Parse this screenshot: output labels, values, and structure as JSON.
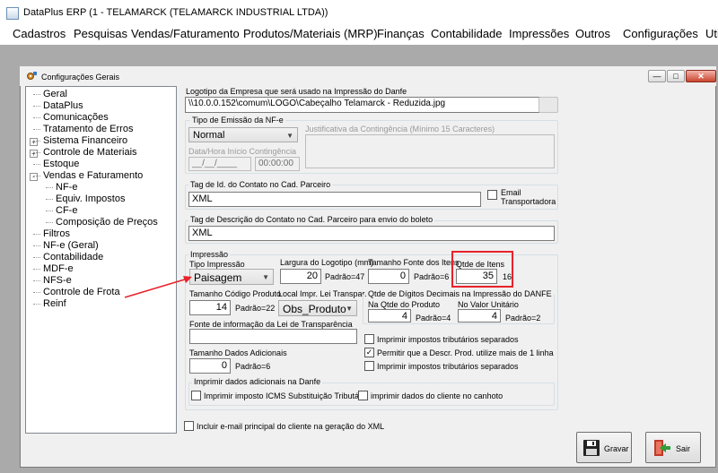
{
  "app": {
    "title": "DataPlus ERP (1 - TELAMARCK  (TELAMARCK INDUSTRIAL LTDA))"
  },
  "menu": [
    "Cadastros",
    "Pesquisas",
    "Vendas/Faturamento",
    "Produtos/Materiais (MRP)",
    "Finanças",
    "Contabilidade",
    "Impressões",
    "Outros",
    "Configurações",
    "Uti"
  ],
  "dialog": {
    "title": "Configurações Gerais"
  },
  "tree": {
    "items": [
      "Geral",
      "DataPlus",
      "Comunicações",
      "Tratamento de Erros",
      "Sistema Financeiro",
      "Controle de Materiais",
      "Estoque",
      "Vendas e Faturamento",
      "NF-e",
      "Equiv. Impostos",
      "CF-e",
      "Composição de Preços",
      "Filtros",
      "NF-e (Geral)",
      "Contabilidade",
      "MDF-e",
      "NFS-e",
      "Controle de Frota",
      "Reinf"
    ],
    "expand_marks": [
      "+",
      "+",
      "-"
    ]
  },
  "logo": {
    "label": "Logotipo da Empresa que será usado na Impressão do Danfe",
    "path": "\\\\10.0.0.152\\comum\\LOGO\\Cabeçalho Telamarck - Reduzida.jpg"
  },
  "emissao": {
    "group": "Tipo de Emissão da NF-e",
    "tipo": "Normal",
    "datahora_label": "Data/Hora Início Contingência",
    "date": "__/__/____",
    "time": "00:00:00",
    "justificativa_label": "Justificativa da Contingência (Mínimo 15 Caracteres)"
  },
  "tag_id": {
    "label": "Tag de Id. do Contato no Cad. Parceiro",
    "value": "XML",
    "email_label": "Email Transportadora"
  },
  "tag_desc": {
    "label": "Tag de Descrição do Contato no Cad. Parceiro para envio do boleto",
    "value": "XML"
  },
  "impressao": {
    "group": "Impressão",
    "tipo_label": "Tipo Impressão",
    "tipo_value": "Paisagem",
    "largura_label": "Largura do Logotipo (mm)",
    "largura_value": "20",
    "largura_padrao": "Padrão=47",
    "fonte_label": "Tamanho Fonte dos Itens",
    "fonte_value": "0",
    "fonte_padrao": "Padrão=6",
    "qtde_label": "Qtde de Itens",
    "qtde_value": "35",
    "qtde_extra": "16",
    "codigo_label": "Tamanho Código Produto",
    "codigo_value": "14",
    "codigo_padrao": "Padrão=22",
    "local_label": "Local Impr. Lei Transpar.",
    "local_value": "Obs_Produto",
    "decimais_group": "Qtde de Dígitos Decimais na Impressão do DANFE",
    "qtde_prod_label": "Na Qtde do Produto",
    "qtde_prod_value": "4",
    "qtde_prod_padrao": "Padrão=4",
    "valor_unit_label": "No Valor Unitário",
    "valor_unit_value": "4",
    "valor_unit_padrao": "Padrão=2",
    "fonte_lei_label": "Fonte de informação da Lei de Transparência",
    "dados_label": "Tamanho Dados Adicionais",
    "dados_value": "0",
    "dados_padrao": "Padrão=6",
    "chk1": "Imprimir impostos tributários separados",
    "chk2": "Permitir que a Descr. Prod. utilize mais de 1 linha",
    "chk3": "Imprimir impostos tributários separados",
    "adic_group": "Imprimir dados adicionais na Danfe",
    "chk_icms": "Imprimir imposto ICMS Substituição Tributária",
    "chk_cliente": "imprimir dados do cliente no canhoto"
  },
  "incluir_email": "Incluir e-mail principal do cliente na geração do XML",
  "buttons": {
    "gravar": "Gravar",
    "sair": "Sair"
  },
  "colors": {
    "highlight": "#e8222a",
    "selection": "#3399ff"
  }
}
